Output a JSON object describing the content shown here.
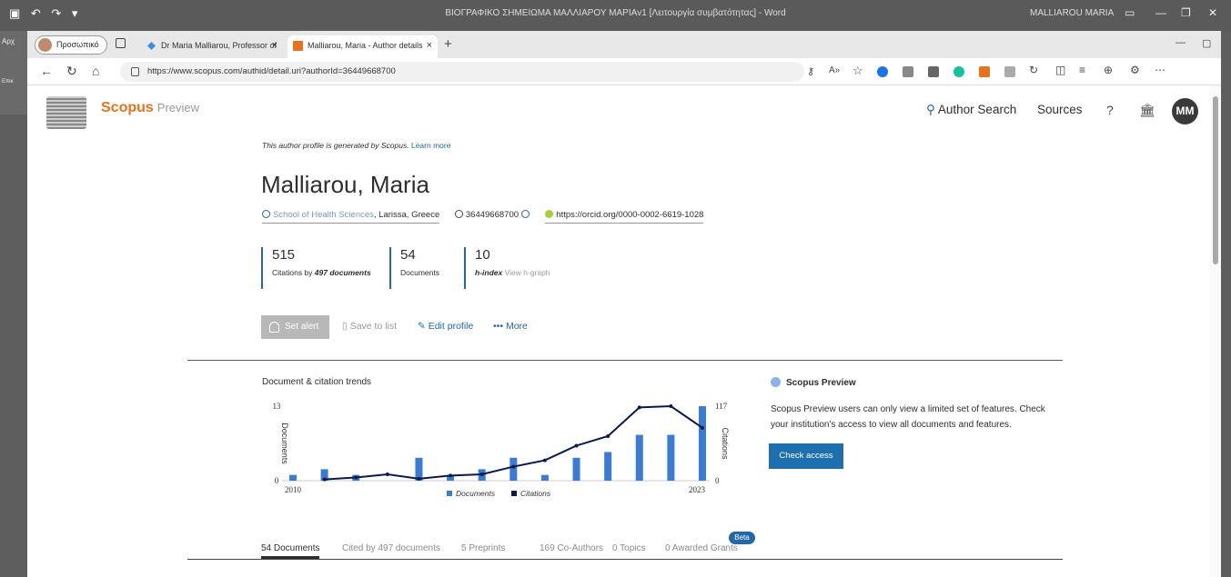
{
  "word": {
    "title": "ΒΙΟΓΡΑΦΙΚΟ ΣΗΜΕΙΩΜΑ ΜΑΛΛΙΑΡΟΥ ΜΑΡΙΑv1 [Λειτουργία συμβατότητας] - Word",
    "user": "MALLIAROU MARIA",
    "left_text_1": "Αρχ",
    "left_text_2": "Επικ"
  },
  "browser": {
    "profile_label": "Προσωπικό",
    "tabs": [
      {
        "label": "Dr Maria Malliarou, Professor of",
        "active": false
      },
      {
        "label": "Malliarou, Maria - Author details",
        "active": true
      }
    ],
    "url": "https://www.scopus.com/authid/detail.uri?authorId=36449668700"
  },
  "header": {
    "brand": "Scopus",
    "brand_suffix": "Preview",
    "author_search": "Author Search",
    "sources": "Sources",
    "avatar_initials": "MM"
  },
  "profile": {
    "generated_note": "This author profile is generated by Scopus.",
    "learn_more": "Learn more",
    "name": "Malliarou, Maria",
    "affiliation": "School of Health Sciences",
    "location": ", Larissa, Greece",
    "author_id": "36449668700",
    "orcid": "https://orcid.org/0000-0002-6619-1028"
  },
  "metrics": {
    "citations": "515",
    "citations_label_pre": "Citations by",
    "citations_docs": "497 documents",
    "documents": "54",
    "documents_label": "Documents",
    "hindex": "10",
    "hindex_label": "h-index",
    "hgraph_label": "View h-graph"
  },
  "actions": {
    "set_alert": "Set alert",
    "save_to_list": "Save to list",
    "edit_profile": "Edit profile",
    "more": "More"
  },
  "chart_data": {
    "type": "bar",
    "title": "Document & citation trends",
    "x": [
      2010,
      2011,
      2012,
      2013,
      2014,
      2015,
      2016,
      2017,
      2018,
      2019,
      2020,
      2021,
      2022,
      2023
    ],
    "x_tick_labels": [
      "2010",
      "2023"
    ],
    "y_left_label": "Documents",
    "y_left_ticks": [
      "13",
      "0"
    ],
    "y_left_max": 13,
    "y_right_label": "Citations",
    "y_right_ticks": [
      "117",
      "0"
    ],
    "y_right_max": 117,
    "series": [
      {
        "name": "Documents",
        "type": "bar",
        "axis": "left",
        "color": "#3a7bd5",
        "values": [
          1,
          2,
          1,
          0,
          4,
          1,
          2,
          4,
          1,
          4,
          5,
          8,
          8,
          13
        ]
      },
      {
        "name": "Citations",
        "type": "line",
        "axis": "right",
        "color": "#0c1a4a",
        "values": [
          null,
          2,
          5,
          10,
          3,
          8,
          10,
          22,
          32,
          55,
          70,
          115,
          117,
          83
        ]
      }
    ],
    "legend_position": "bottom"
  },
  "sidebar": {
    "title": "Scopus Preview",
    "text": "Scopus Preview users can only view a limited set of features. Check your institution's access to view all documents and features.",
    "button": "Check access"
  },
  "tabs": [
    {
      "label": "54 Documents",
      "active": true
    },
    {
      "label": "Cited by 497 documents",
      "active": false
    },
    {
      "label": "5 Preprints",
      "active": false
    },
    {
      "label": "169 Co-Authors",
      "active": false
    },
    {
      "label": "0 Topics",
      "active": false
    },
    {
      "label": "0 Awarded Grants",
      "active": false
    }
  ],
  "beta_badge": "Beta",
  "colors": {
    "accent": "#2267a8",
    "brand": "#e9711c",
    "button": "#1e6fad"
  }
}
